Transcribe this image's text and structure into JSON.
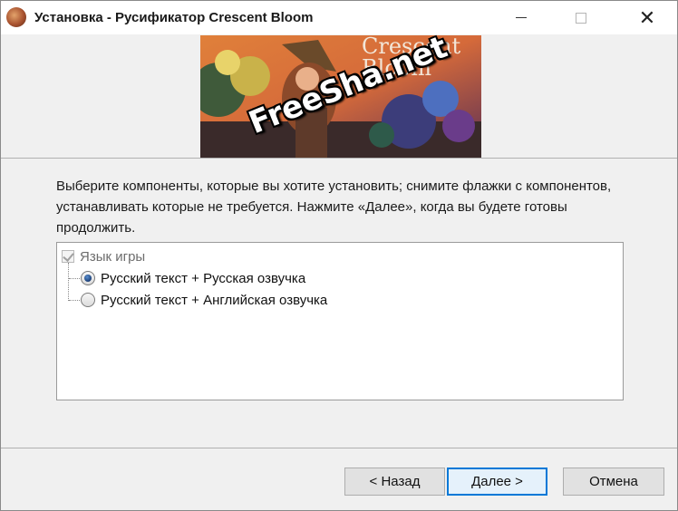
{
  "window": {
    "title": "Установка - Русификатор Crescent Bloom",
    "controls": {
      "minimize": "minimize",
      "maximize": "maximize",
      "close": "✕"
    }
  },
  "banner": {
    "game_title_line1": "Crescent",
    "game_title_line2": "Bloom",
    "watermark": "FreeSha.net"
  },
  "instructions": "Выберите компоненты, которые вы хотите установить; снимите флажки с компонентов, устанавливать которые не требуется. Нажмите «Далее», когда вы будете готовы продолжить.",
  "components": {
    "root": {
      "label": "Язык игры",
      "checked": true,
      "disabled": true
    },
    "options": [
      {
        "label": "Русский текст + Русская озвучка",
        "selected": true
      },
      {
        "label": "Русский текст + Английская озвучка",
        "selected": false
      }
    ]
  },
  "buttons": {
    "back": "< Назад",
    "next": "Далее >",
    "cancel": "Отмена"
  },
  "colors": {
    "focus_border": "#0078d7",
    "window_bg": "#f0f0f0"
  }
}
